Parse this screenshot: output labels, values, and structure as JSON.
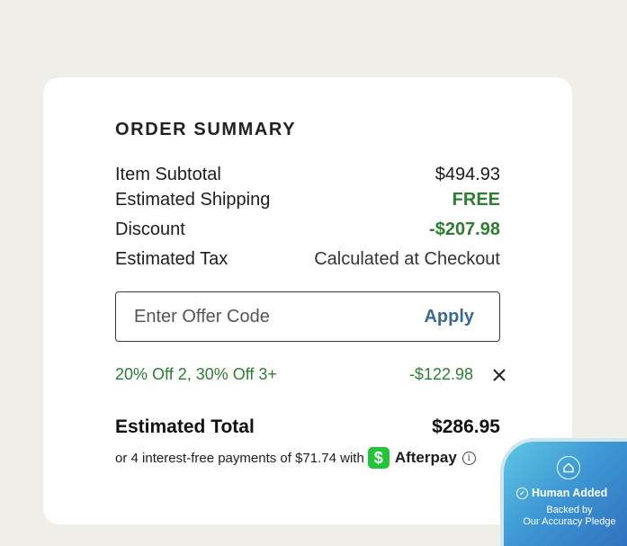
{
  "summary": {
    "title": "ORDER SUMMARY",
    "rows": [
      {
        "label": "Item Subtotal",
        "value": "$494.93"
      },
      {
        "label": "Estimated Shipping",
        "value": "FREE"
      },
      {
        "label": "Discount",
        "value": "-$207.98"
      },
      {
        "label": "Estimated Tax",
        "value": "Calculated at Checkout"
      }
    ]
  },
  "offer": {
    "placeholder": "Enter Offer Code",
    "value": "",
    "apply_label": "Apply"
  },
  "promo": {
    "name": "20% Off 2, 30% Off 3+",
    "amount": "-$122.98",
    "remove_icon": "close-icon"
  },
  "total": {
    "label": "Estimated Total",
    "value": "$286.95"
  },
  "afterpay": {
    "text": "or 4 interest-free payments of $71.74 with",
    "cash_symbol": "$",
    "brand": "Afterpay",
    "info_symbol": "i"
  },
  "badge": {
    "title": "Human Added",
    "line1": "Backed by",
    "line2": "Our Accuracy Pledge"
  },
  "colors": {
    "background": "#efeee9",
    "card": "#ffffff",
    "discount_green": "#2e7d32",
    "apply_blue": "#3c6a8f",
    "cash_app_green": "#23c33a",
    "badge_blue": "#3e98d4"
  }
}
